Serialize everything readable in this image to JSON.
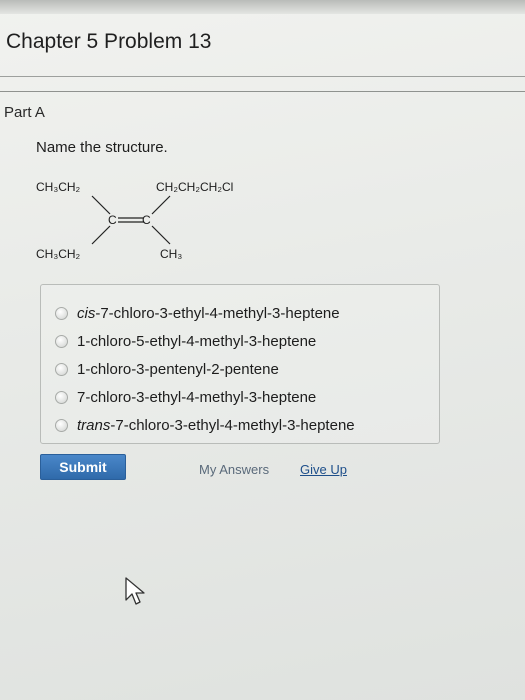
{
  "header": {
    "title": "Chapter 5 Problem 13"
  },
  "part": {
    "label": "Part A",
    "prompt": "Name the structure."
  },
  "structure": {
    "top_left": "CH₃CH₂",
    "top_right": "CH₂CH₂CH₂Cl",
    "bottom_left": "CH₃CH₂",
    "bottom_right": "CH₃",
    "atom_left": "C",
    "atom_right": "C"
  },
  "options": [
    {
      "prefix": "cis",
      "text": "-7-chloro-3-ethyl-4-methyl-3-heptene"
    },
    {
      "prefix": "",
      "text": "1-chloro-5-ethyl-4-methyl-3-heptene"
    },
    {
      "prefix": "",
      "text": "1-chloro-3-pentenyl-2-pentene"
    },
    {
      "prefix": "",
      "text": "7-chloro-3-ethyl-4-methyl-3-heptene"
    },
    {
      "prefix": "trans",
      "text": "-7-chloro-3-ethyl-4-methyl-3-heptene"
    }
  ],
  "actions": {
    "submit_label": "Submit",
    "my_answers_label": "My Answers",
    "give_up_label": "Give Up"
  },
  "icons": {
    "cursor": "mouse-pointer-icon",
    "radio": "radio-button-icon"
  },
  "colors": {
    "submit_bg": "#3a78bb",
    "link": "#1e4f8a",
    "background": "#eceeeb"
  }
}
